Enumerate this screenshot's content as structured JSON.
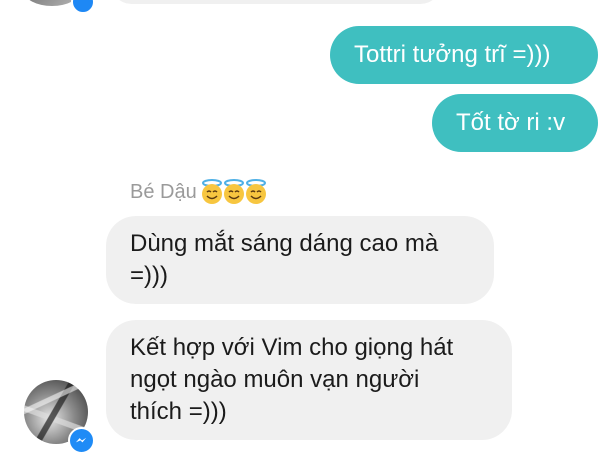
{
  "conversation": {
    "sent_messages": [
      "Tottri tưởng trĩ =)))",
      "Tốt tờ ri :v"
    ],
    "sender_name": "Bé Dậu",
    "sender_emojis": [
      "smiling-face-with-halo",
      "smiling-face-with-halo",
      "smiling-face-with-halo"
    ],
    "received_messages": [
      "Dùng mắt sáng dáng cao mà\n=)))",
      "Kết hợp với Vim cho giọng hát\nngọt ngào muôn vạn người\nthích =)))"
    ]
  },
  "colors": {
    "outgoing_bubble": "#3fbfc0",
    "incoming_bubble": "#f0f0f0",
    "messenger_badge": "#1f8bf6",
    "sender_name_text": "#9a9a9a"
  },
  "icons": {
    "messenger_badge": "messenger-icon",
    "halo_emoji": "smiling-face-with-halo-icon"
  }
}
